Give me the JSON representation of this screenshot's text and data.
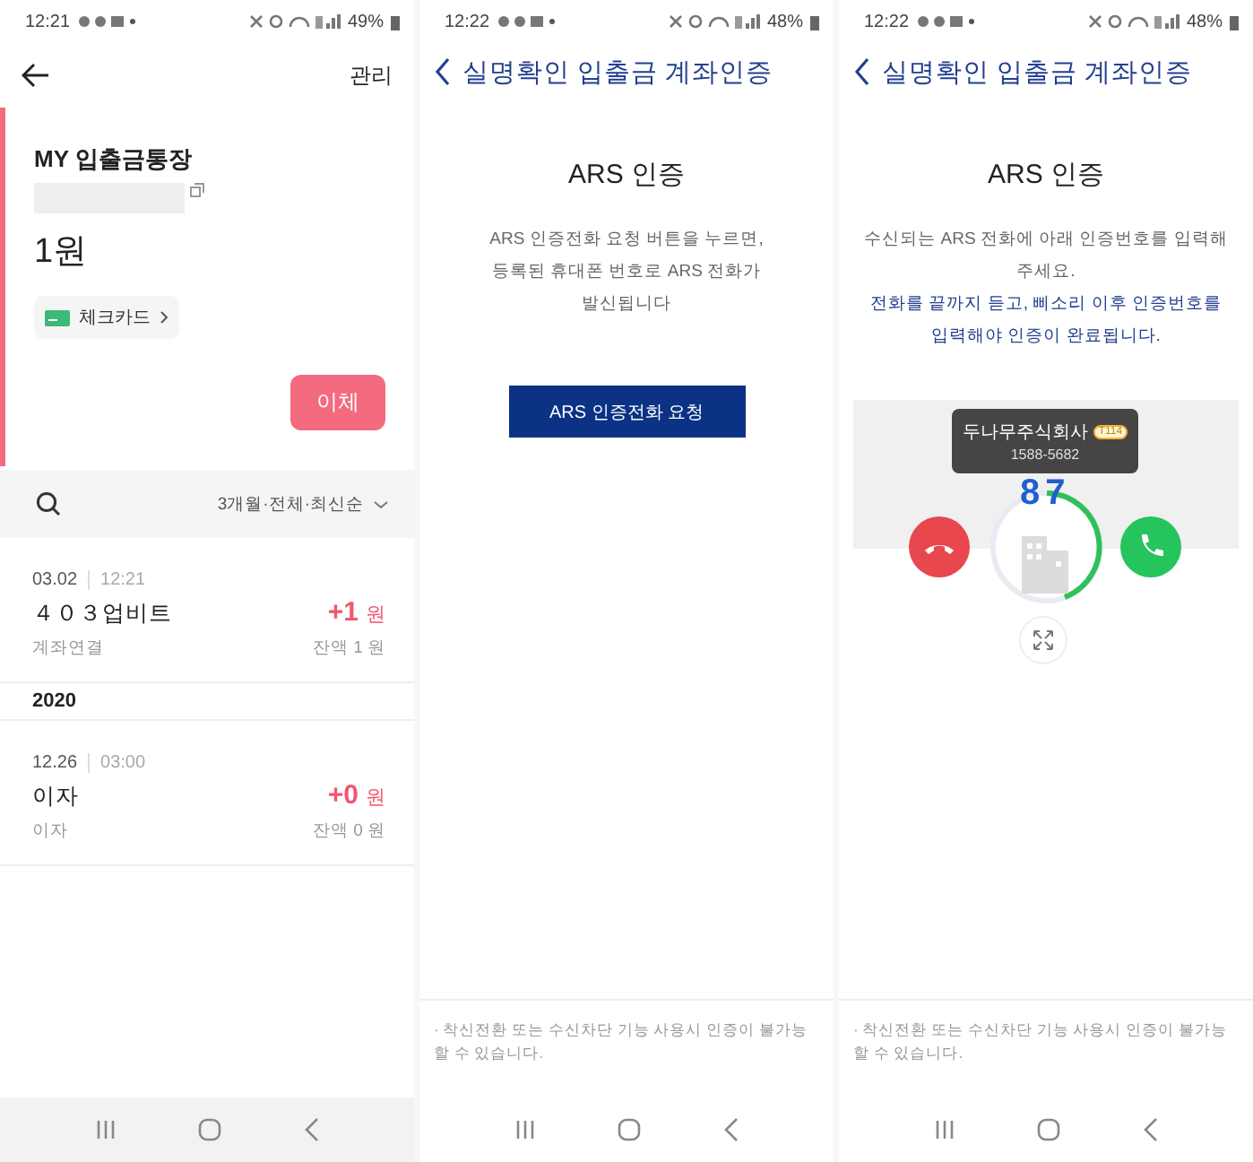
{
  "panels": [
    {
      "kind": "account",
      "status_bar": {
        "time": "12:21",
        "battery": "49%"
      },
      "header": {
        "action": "관리"
      },
      "account": {
        "name": "MY 입출금통장",
        "balance": "1원",
        "card_chip": "체크카드",
        "transfer_button": "이체"
      },
      "filter": {
        "label": "3개월·전체·최신순"
      },
      "transactions": [
        {
          "kind": "entry",
          "date": "03.02",
          "time": "12:21",
          "title": "４０３업비트",
          "subtitle": "계좌연결",
          "amount": "+1",
          "unit": "원",
          "balance": "잔액 1 원"
        },
        {
          "kind": "year",
          "label": "2020"
        },
        {
          "kind": "entry",
          "date": "12.26",
          "time": "03:00",
          "title": "이자",
          "subtitle": "이자",
          "amount": "+0",
          "unit": "원",
          "balance": "잔액 0 원"
        }
      ]
    },
    {
      "kind": "ars_request",
      "status_bar": {
        "time": "12:22",
        "battery": "48%"
      },
      "header": {
        "title": "실명확인 입출금 계좌인증"
      },
      "heading": "ARS 인증",
      "paragraphs": [
        {
          "text": "ARS 인증전화 요청 버튼을 누르면, 등록된 휴대폰 번호로 ARS 전화가 발신됩니다",
          "highlight": false
        }
      ],
      "request_button": "ARS 인증전화 요청",
      "note": "· 착신전환 또는 수신차단 기능 사용시 인증이 불가능할 수 있습니다."
    },
    {
      "kind": "ars_call",
      "status_bar": {
        "time": "12:22",
        "battery": "48%"
      },
      "header": {
        "title": "실명확인 입출금 계좌인증"
      },
      "heading": "ARS 인증",
      "paragraphs": [
        {
          "text": "수신되는 ARS 전화에 아래 인증번호를 입력해주세요.",
          "highlight": false
        },
        {
          "text": "전화를 끝까지 듣고, 삐소리 이후 인증번호를 입력해야 인증이 완료됩니다.",
          "highlight": true
        }
      ],
      "call": {
        "code": "87",
        "caller": "두나무주식회사",
        "caller_tag": "T114",
        "number": "1588-5682"
      },
      "note": "· 착신전환 또는 수신차단 기능 사용시 인증이 불가능할 수 있습니다."
    }
  ]
}
